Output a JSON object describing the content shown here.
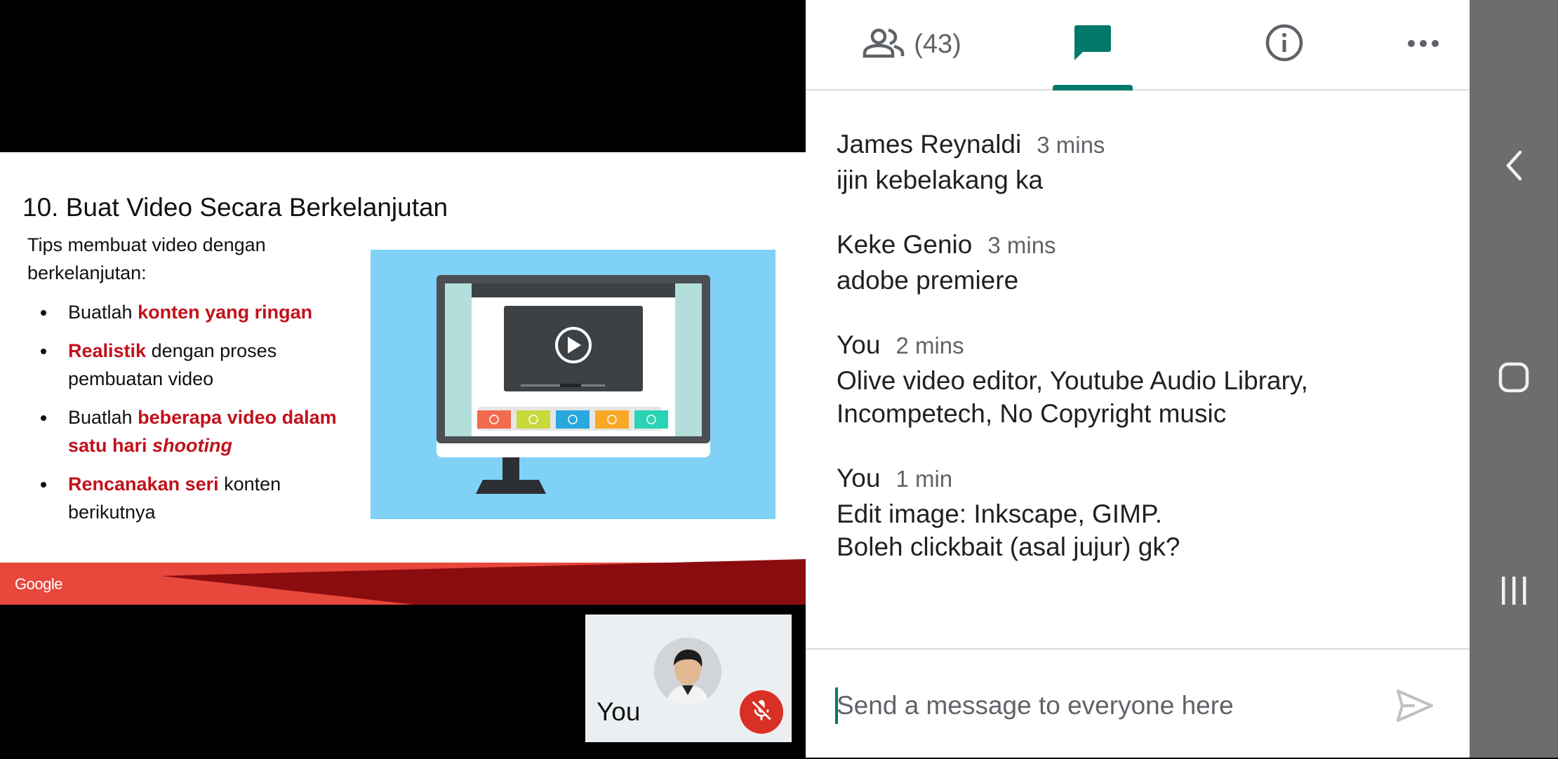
{
  "slide": {
    "title": "10. Buat Video Secara Berkelanjutan",
    "intro": "Tips membuat video dengan berkelanjutan:",
    "bullets": [
      {
        "segments": [
          {
            "text": "Buatlah ",
            "style": "normal"
          },
          {
            "text": "konten yang ringan",
            "style": "highlight"
          }
        ]
      },
      {
        "segments": [
          {
            "text": "Realistik",
            "style": "highlight"
          },
          {
            "text": " dengan proses pembuatan video",
            "style": "normal"
          }
        ]
      },
      {
        "segments": [
          {
            "text": "Buatlah ",
            "style": "normal"
          },
          {
            "text": "beberapa video dalam satu hari ",
            "style": "highlight"
          },
          {
            "text": "shooting",
            "style": "highlight-italic"
          }
        ]
      },
      {
        "segments": [
          {
            "text": "Rencanakan seri",
            "style": "highlight"
          },
          {
            "text": " konten berikutnya",
            "style": "normal"
          }
        ]
      }
    ],
    "footer_logo": "Google",
    "highlight_color": "#c2111b",
    "footer_colors": {
      "light": "#e8473c",
      "dark": "#8b0c0f"
    }
  },
  "self_view": {
    "label": "You",
    "mic_state": "muted",
    "mic_icon": "mic-off-icon"
  },
  "tabs": {
    "people": {
      "icon": "people-icon",
      "count": "(43)"
    },
    "chat": {
      "icon": "chat-bubble-icon",
      "active": true
    },
    "info": {
      "icon": "info-icon"
    },
    "more": {
      "icon": "more-horizontal-icon"
    }
  },
  "messages": [
    {
      "sender": "James Reynaldi",
      "time": "3 mins",
      "text": "ijin kebelakang ka"
    },
    {
      "sender": "Keke Genio",
      "time": "3 mins",
      "text": "adobe premiere"
    },
    {
      "sender": "You",
      "time": "2 mins",
      "text": "Olive video editor, Youtube Audio Library,\nIncompetech, No Copyright music"
    },
    {
      "sender": "You",
      "time": "1 min",
      "text": "Edit image: Inkscape, GIMP.\nBoleh clickbait (asal jujur) gk?"
    }
  ],
  "compose": {
    "placeholder": "Send a message to everyone here",
    "value": "",
    "send_icon": "send-icon"
  },
  "navbar": {
    "back_icon": "back-icon",
    "home_icon": "home-icon",
    "recents_icon": "recents-icon"
  },
  "colors": {
    "accent": "#00796b",
    "mic_off": "#d93025",
    "navbar": "#6d6d6d"
  }
}
